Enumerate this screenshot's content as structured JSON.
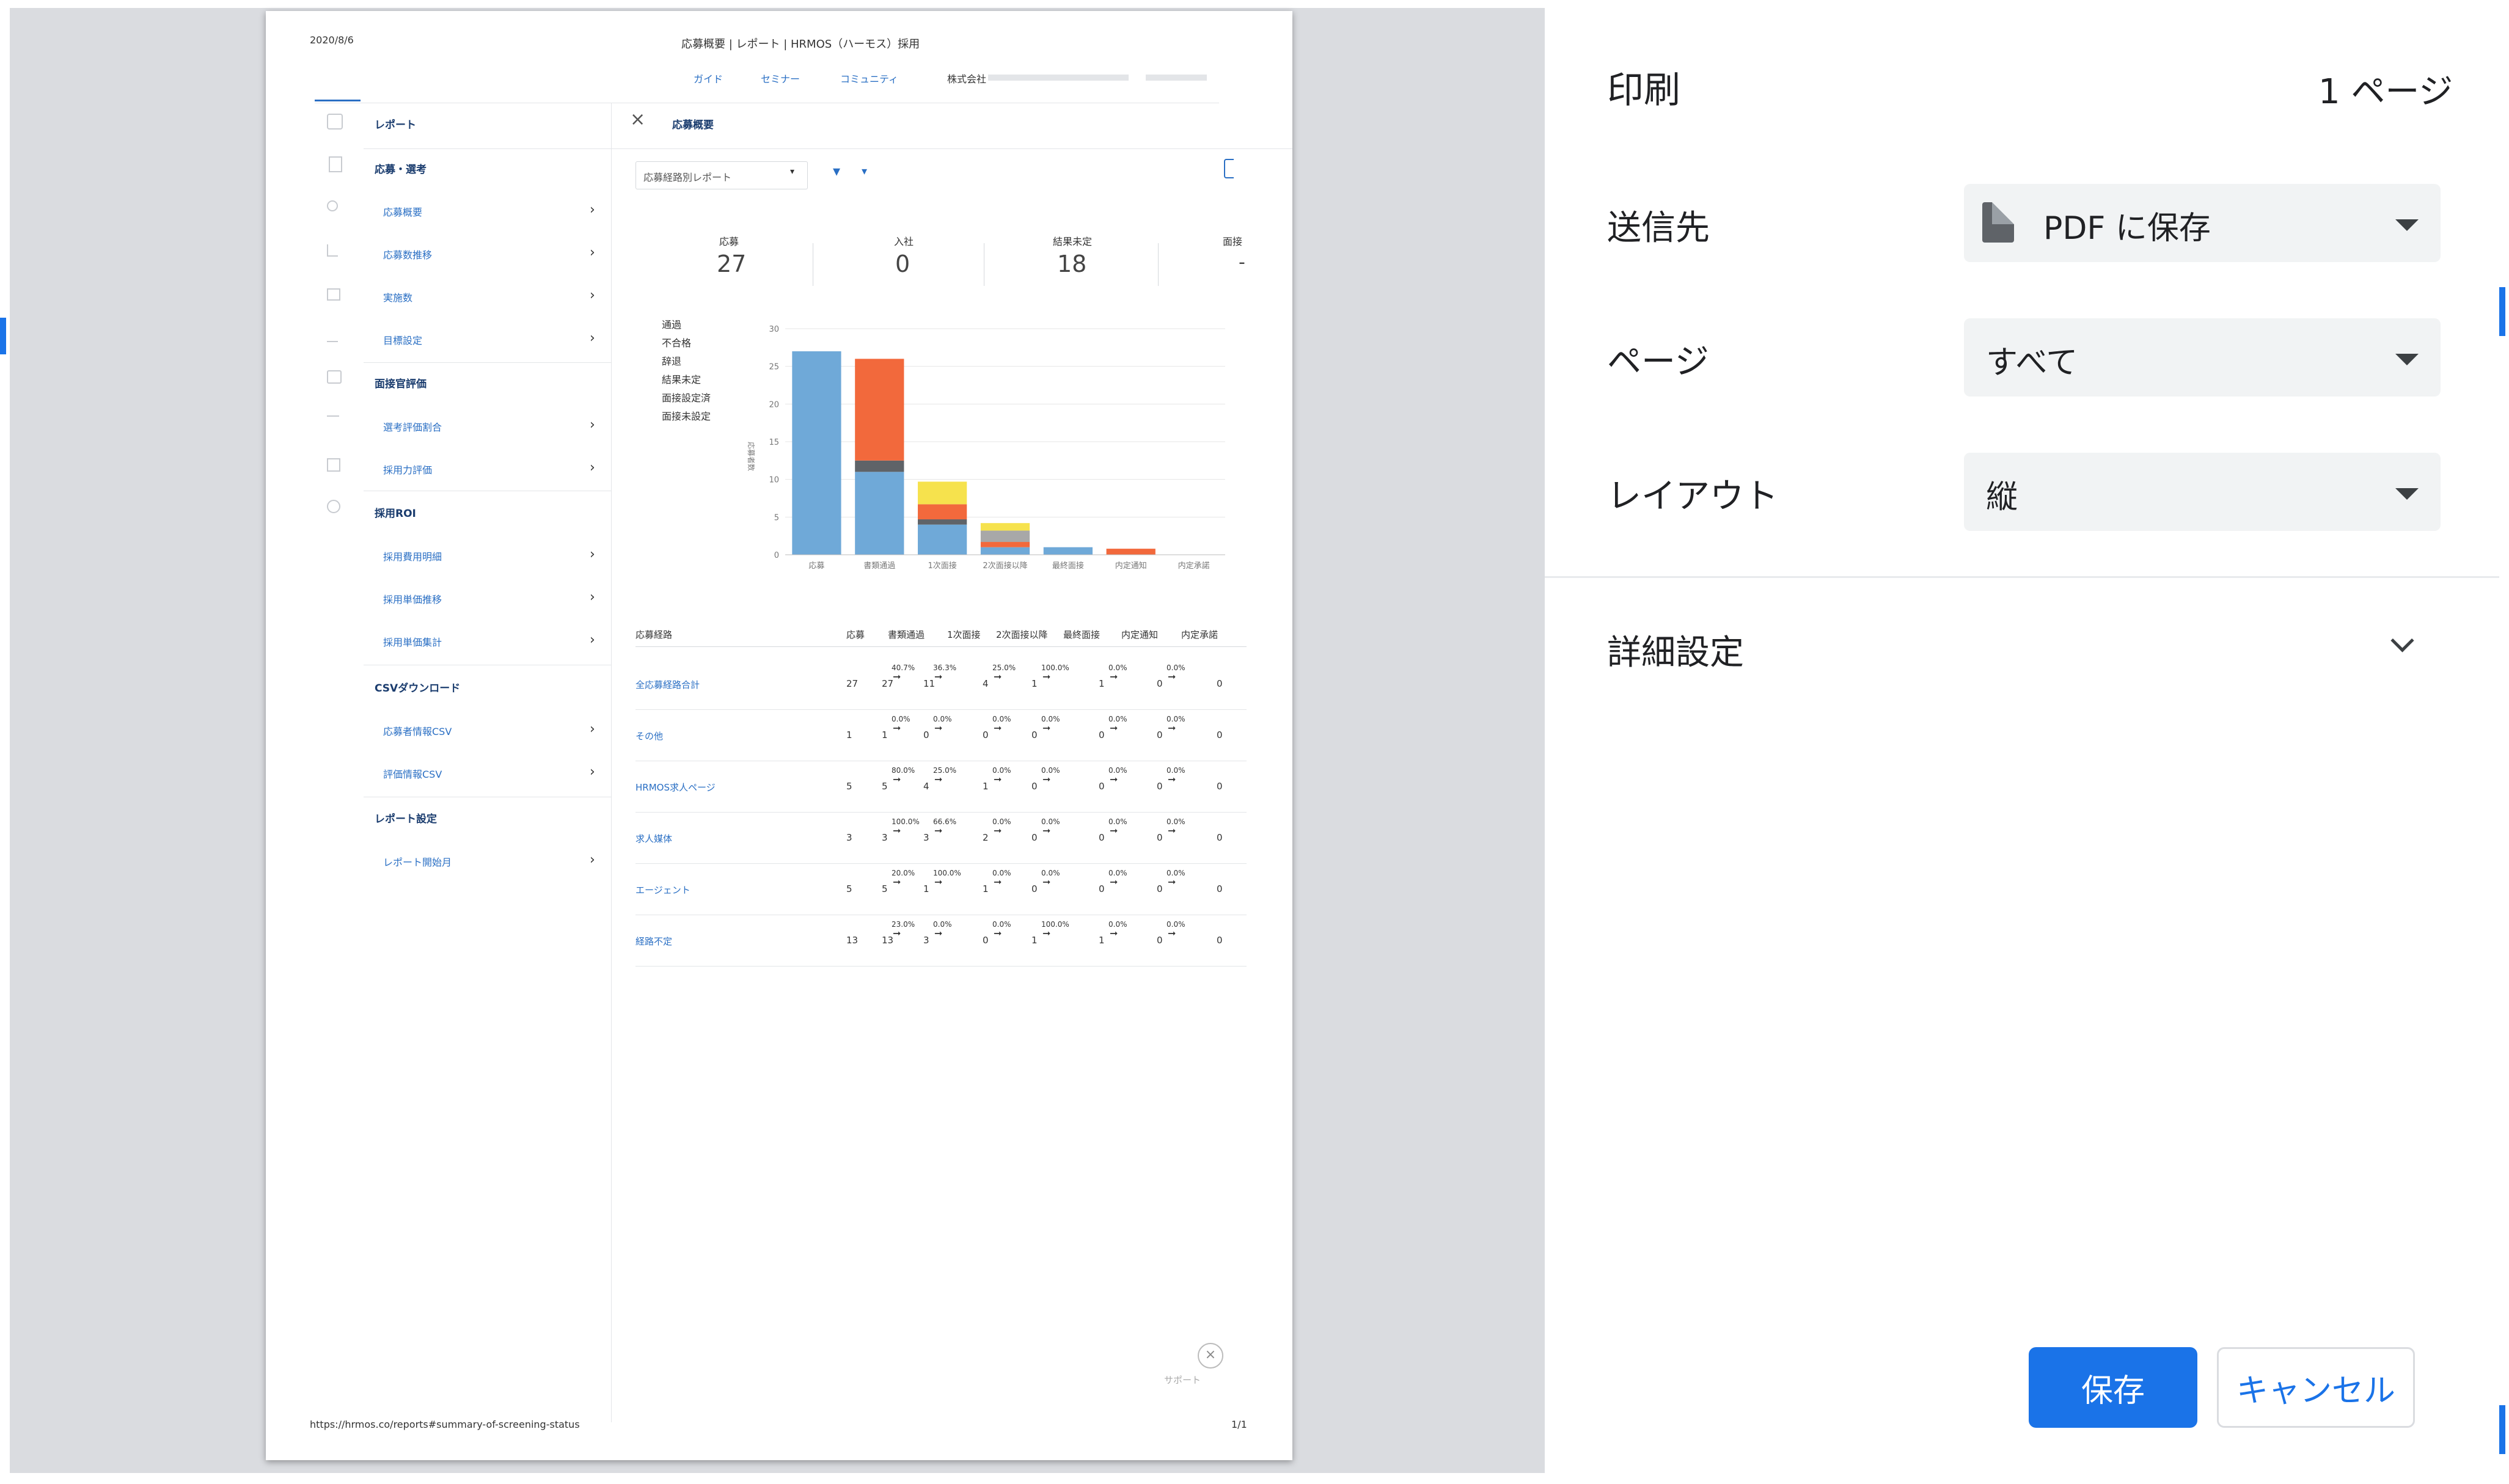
{
  "preview": {
    "date": "2020/8/6",
    "browser_title": "応募概要 | レポート | HRMOS（ハーモス）採用",
    "top_links": [
      "ガイド",
      "セミナー",
      "コミュニティ"
    ],
    "company": "株式会社",
    "sidebar": {
      "header": "レポート",
      "sections": [
        {
          "title": "応募・選考",
          "items": [
            "応募概要",
            "応募数推移",
            "実施数",
            "目標設定"
          ]
        },
        {
          "title": "面接官評価",
          "items": [
            "選考評価割合",
            "採用力評価"
          ]
        },
        {
          "title": "採用ROI",
          "items": [
            "採用費用明細",
            "採用単価推移",
            "採用単価集計"
          ]
        },
        {
          "title": "CSVダウンロード",
          "items": [
            "応募者情報CSV",
            "評価情報CSV"
          ]
        },
        {
          "title": "レポート設定",
          "items": [
            "レポート開始月"
          ]
        }
      ]
    },
    "main": {
      "title": "応募概要",
      "report_select": "応募経路別レポート",
      "summary": [
        {
          "label": "応募",
          "value": "27"
        },
        {
          "label": "入社",
          "value": "0"
        },
        {
          "label": "結果未定",
          "value": "18"
        },
        {
          "label": "面接",
          "value": "-"
        }
      ],
      "legend": [
        "通過",
        "不合格",
        "辞退",
        "結果未定",
        "面接設定済",
        "面接未設定"
      ],
      "table": {
        "headers": [
          "応募経路",
          "応募",
          "書類通過",
          "1次面接",
          "2次面接以降",
          "最終面接",
          "内定通知",
          "内定承諾"
        ],
        "rows": [
          {
            "name": "全応募経路合計",
            "apply": "27",
            "vals": [
              "27",
              "11",
              "4",
              "1",
              "1",
              "0",
              "0"
            ],
            "pcts": [
              "40.7%",
              "36.3%",
              "25.0%",
              "100.0%",
              "0.0%",
              "0.0%"
            ]
          },
          {
            "name": "その他",
            "apply": "1",
            "vals": [
              "1",
              "0",
              "0",
              "0",
              "0",
              "0",
              "0"
            ],
            "pcts": [
              "0.0%",
              "0.0%",
              "0.0%",
              "0.0%",
              "0.0%",
              "0.0%"
            ]
          },
          {
            "name": "HRMOS求人ページ",
            "apply": "5",
            "vals": [
              "5",
              "4",
              "1",
              "0",
              "0",
              "0",
              "0"
            ],
            "pcts": [
              "80.0%",
              "25.0%",
              "0.0%",
              "0.0%",
              "0.0%",
              "0.0%"
            ]
          },
          {
            "name": "求人媒体",
            "apply": "3",
            "vals": [
              "3",
              "3",
              "2",
              "0",
              "0",
              "0",
              "0"
            ],
            "pcts": [
              "100.0%",
              "66.6%",
              "0.0%",
              "0.0%",
              "0.0%",
              "0.0%"
            ]
          },
          {
            "name": "エージェント",
            "apply": "5",
            "vals": [
              "5",
              "1",
              "1",
              "0",
              "0",
              "0",
              "0"
            ],
            "pcts": [
              "20.0%",
              "100.0%",
              "0.0%",
              "0.0%",
              "0.0%",
              "0.0%"
            ]
          },
          {
            "name": "経路不定",
            "apply": "13",
            "vals": [
              "13",
              "3",
              "0",
              "1",
              "1",
              "0",
              "0"
            ],
            "pcts": [
              "23.0%",
              "0.0%",
              "0.0%",
              "100.0%",
              "0.0%",
              "0.0%"
            ]
          }
        ]
      },
      "support": "サポート"
    },
    "footer_url": "https://hrmos.co/reports#summary-of-screening-status",
    "footer_page": "1/1"
  },
  "print_panel": {
    "title": "印刷",
    "page_count": "1 ページ",
    "destination": {
      "label": "送信先",
      "value": "PDF に保存"
    },
    "pages": {
      "label": "ページ",
      "value": "すべて"
    },
    "layout": {
      "label": "レイアウト",
      "value": "縦"
    },
    "advanced": {
      "label": "詳細設定"
    },
    "save_button": "保存",
    "cancel_button": "キャンセル"
  },
  "chart_data": {
    "type": "bar",
    "categories": [
      "応募",
      "書類通過",
      "1次面接",
      "2次面接以降",
      "最終面接",
      "内定通知",
      "内定承諾"
    ],
    "ylim": [
      0,
      30
    ],
    "yticks": [
      0,
      5,
      10,
      15,
      20,
      25,
      30
    ],
    "ylabel": "応募者数",
    "series": [
      {
        "name": "通過",
        "color": "#6fa9d8",
        "values": [
          27,
          11,
          4,
          1,
          1,
          0,
          0
        ]
      },
      {
        "name": "辞退",
        "color": "#5f6368",
        "values": [
          0,
          1.5,
          0.7,
          0,
          0,
          0,
          0
        ]
      },
      {
        "name": "不合格",
        "color": "#f2693c",
        "values": [
          0,
          13.5,
          2,
          0.7,
          0,
          0.8,
          0
        ]
      },
      {
        "name": "結果未定",
        "color": "#a8a8a8",
        "values": [
          0,
          0,
          0,
          1.5,
          0,
          0,
          0
        ]
      },
      {
        "name": "面接設定済",
        "color": "#f6e24d",
        "values": [
          0,
          0,
          3,
          1,
          0,
          0,
          0
        ]
      }
    ]
  }
}
